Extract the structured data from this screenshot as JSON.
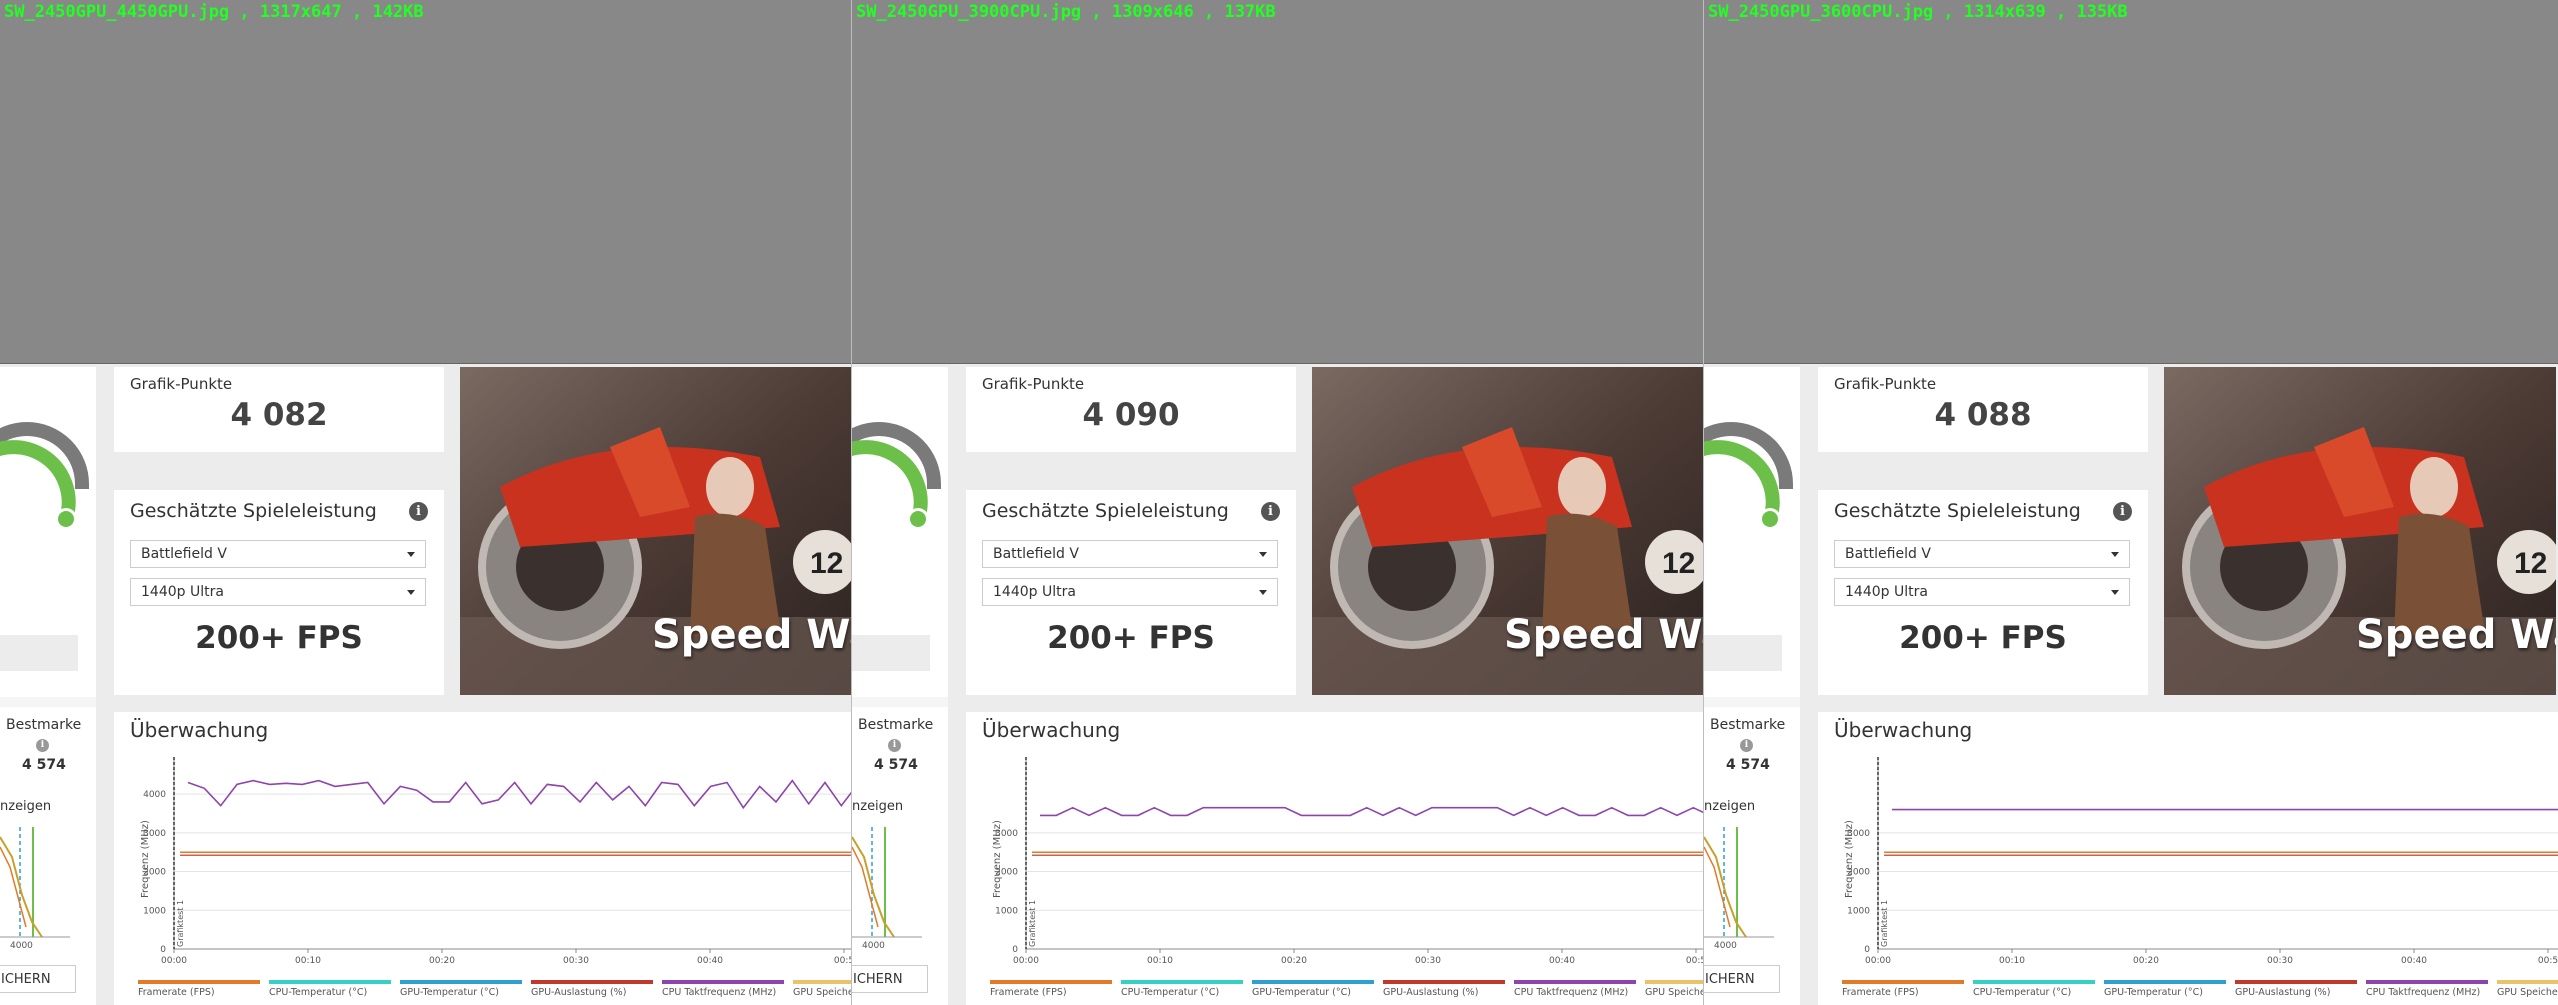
{
  "panels": [
    {
      "caption": "SW_2450GPU_4450GPU.jpg , 1317x647 , 142KB",
      "grafik_label": "Grafik-Punkte",
      "grafik_value": "4 082",
      "est_title": "Geschätzte Spieleleistung",
      "game": "Battlefield V",
      "preset": "1440p Ultra",
      "fps": "200+ FPS",
      "art_title": "Speed Way",
      "best_label": "Bestmarke",
      "best_value": "4 574",
      "anzeigen": "nzeigen",
      "mini_tick": "4000",
      "save": "ICHERN",
      "mon_title": "Überwachung",
      "ylabel": "Frequenz (MHz)",
      "marker": "Grafiktest 1",
      "yticks": [
        "4000",
        "3000",
        "2000",
        "1000",
        "0"
      ],
      "xticks": [
        "00:00",
        "00:10",
        "00:20",
        "00:30",
        "00:40",
        "00:5"
      ],
      "purple_series_mhz": [
        4300,
        4150,
        3700,
        4250,
        4350,
        4250,
        4280,
        4250,
        4350,
        4200,
        4250,
        4300,
        3750,
        4200,
        4100,
        3800,
        3800,
        4300,
        3750,
        3850,
        4300,
        3750,
        4250,
        4200,
        3800,
        4300,
        3850,
        4200,
        3700,
        4300,
        4250,
        3700,
        4200,
        4300,
        3650,
        4200,
        3800,
        4350,
        3750,
        4300,
        3700,
        4250,
        3750
      ],
      "orange_mhz": 2500,
      "red_mhz": 2420
    },
    {
      "caption": "SW_2450GPU_3900CPU.jpg , 1309x646 , 137KB",
      "grafik_label": "Grafik-Punkte",
      "grafik_value": "4 090",
      "est_title": "Geschätzte Spieleleistung",
      "game": "Battlefield V",
      "preset": "1440p Ultra",
      "fps": "200+ FPS",
      "art_title": "Speed Way",
      "best_label": "Bestmarke",
      "best_value": "4 574",
      "anzeigen": "nzeigen",
      "mini_tick": "4000",
      "save": "ICHERN",
      "mon_title": "Überwachung",
      "ylabel": "Frequenz (MHz)",
      "marker": "Grafiktest 1",
      "yticks": [
        "3000",
        "2000",
        "1000",
        "0"
      ],
      "xticks": [
        "00:00",
        "00:10",
        "00:20",
        "00:30",
        "00:40",
        "00:5"
      ],
      "purple_series_mhz": [
        3450,
        3450,
        3650,
        3450,
        3650,
        3450,
        3450,
        3650,
        3450,
        3450,
        3650,
        3650,
        3650,
        3650,
        3650,
        3650,
        3450,
        3450,
        3450,
        3450,
        3650,
        3450,
        3650,
        3450,
        3650,
        3650,
        3650,
        3650,
        3650,
        3450,
        3650,
        3450,
        3650,
        3450,
        3450,
        3650,
        3450,
        3450,
        3650,
        3450,
        3650,
        3450,
        3650
      ],
      "orange_mhz": 2500,
      "red_mhz": 2420
    },
    {
      "caption": "SW_2450GPU_3600CPU.jpg , 1314x639 , 135KB",
      "grafik_label": "Grafik-Punkte",
      "grafik_value": "4 088",
      "est_title": "Geschätzte Spieleleistung",
      "game": "Battlefield V",
      "preset": "1440p Ultra",
      "fps": "200+ FPS",
      "art_title": "Speed Way",
      "best_label": "Bestmarke",
      "best_value": "4 574",
      "anzeigen": "nzeigen",
      "mini_tick": "4000",
      "save": "ICHERN",
      "mon_title": "Überwachung",
      "ylabel": "Frequenz (MHz)",
      "marker": "Grafiktest 1",
      "yticks": [
        "3000",
        "2000",
        "1000",
        "0"
      ],
      "xticks": [
        "00:00",
        "00:10",
        "00:20",
        "00:30",
        "00:40",
        "00:5"
      ],
      "purple_series_mhz": [
        3600,
        3600,
        3600,
        3600,
        3600,
        3600,
        3600,
        3600,
        3600,
        3600,
        3600,
        3600,
        3600,
        3600,
        3600,
        3600,
        3600,
        3600,
        3600,
        3600,
        3600,
        3600,
        3600,
        3600,
        3600,
        3600,
        3600,
        3600,
        3600,
        3600,
        3600,
        3600,
        3600,
        3600,
        3600,
        3600,
        3600,
        3600,
        3600,
        3600,
        3600,
        3600,
        3600
      ],
      "orange_mhz": 2500,
      "red_mhz": 2420
    }
  ],
  "legend": [
    {
      "label": "Framerate (FPS)",
      "color": "#e07b2a"
    },
    {
      "label": "CPU-Temperatur (°C)",
      "color": "#36d1c4"
    },
    {
      "label": "GPU-Temperatur (°C)",
      "color": "#2fa0d0"
    },
    {
      "label": "GPU-Auslastung (%)",
      "color": "#c0392b"
    },
    {
      "label": "CPU Taktfrequenz (MHz)",
      "color": "#8e44ad"
    },
    {
      "label": "GPU Speicher",
      "color": "#e8c36a"
    }
  ],
  "colors": {
    "gauge_green": "#6cc04a",
    "gauge_grey": "#7a7a7a",
    "purple": "#8e44ad",
    "orange": "#e07b2a",
    "red": "#c0392b",
    "screenshot_grey": "#888888",
    "caption_green": "#22ff22"
  }
}
